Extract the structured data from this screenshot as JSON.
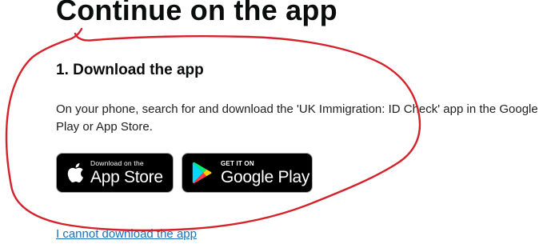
{
  "page": {
    "title": "Continue on the app"
  },
  "step": {
    "heading": "1. Download the app",
    "instructions": "On your phone, search for and download the 'UK Immigration: ID Check' app in the Google Play or App Store."
  },
  "badges": {
    "app_store": {
      "small_text": "Download on the",
      "large_text": "App Store",
      "icon": "apple-icon"
    },
    "google_play": {
      "small_text": "GET IT ON",
      "large_text": "Google Play",
      "icon": "google-play-icon"
    }
  },
  "links": {
    "cannot_download": "I cannot download the app"
  },
  "colors": {
    "text": "#0b0c0c",
    "link": "#1d70b8",
    "annotation": "#d4212a",
    "badge_background": "#000000"
  }
}
